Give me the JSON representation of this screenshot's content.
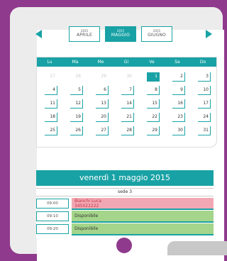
{
  "nav": {
    "months": [
      {
        "year": "2015",
        "name": "APRILE"
      },
      {
        "year": "2015",
        "name": "MAGGIO"
      },
      {
        "year": "2015",
        "name": "GIUGNO"
      }
    ]
  },
  "calendar": {
    "weekdays": [
      "Lu",
      "Ma",
      "Me",
      "Gi",
      "Ve",
      "Sa",
      "Do"
    ],
    "rows": [
      [
        "27",
        "28",
        "29",
        "30",
        "1",
        "2",
        "3"
      ],
      [
        "4",
        "5",
        "6",
        "7",
        "8",
        "9",
        "10"
      ],
      [
        "11",
        "12",
        "13",
        "14",
        "15",
        "16",
        "17"
      ],
      [
        "18",
        "19",
        "20",
        "21",
        "22",
        "23",
        "24"
      ],
      [
        "25",
        "26",
        "27",
        "28",
        "29",
        "30",
        "31"
      ]
    ],
    "selected": "1"
  },
  "day": {
    "title": "venerdì 1 maggio 2015",
    "sede": "sede 3",
    "slots": [
      {
        "time": "09:00",
        "line1": "Bianchi Luca",
        "line2": "345022222",
        "status": "busy"
      },
      {
        "time": "09:10",
        "line1": "Disponibile",
        "line2": "",
        "status": "free"
      },
      {
        "time": "09:20",
        "line1": "Disponibile",
        "line2": "",
        "status": "free"
      }
    ]
  },
  "colors": {
    "accent": "#19a2a5",
    "frame": "#8f3a8d",
    "busy": "#f2a8b4",
    "free": "#a4d58a"
  }
}
